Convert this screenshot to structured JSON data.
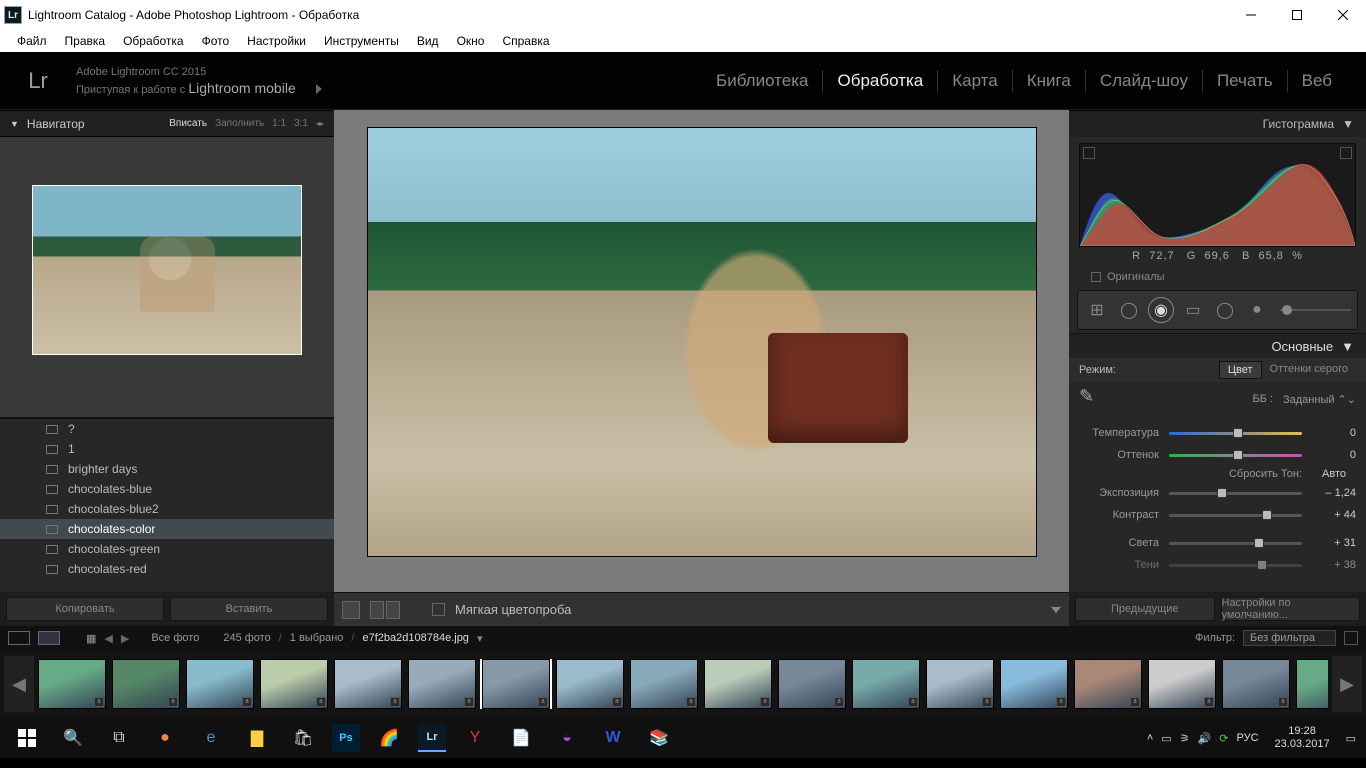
{
  "window": {
    "title": "Lightroom Catalog - Adobe Photoshop Lightroom - Обработка"
  },
  "menubar": [
    "Файл",
    "Правка",
    "Обработка",
    "Фото",
    "Настройки",
    "Инструменты",
    "Вид",
    "Окно",
    "Справка"
  ],
  "identity": {
    "logo": "Lr",
    "version": "Adobe Lightroom CC 2015",
    "mobile_prefix": "Приступая к работе с ",
    "mobile": "Lightroom mobile"
  },
  "modules": [
    {
      "label": "Библиотека",
      "active": false
    },
    {
      "label": "Обработка",
      "active": true
    },
    {
      "label": "Карта",
      "active": false
    },
    {
      "label": "Книга",
      "active": false
    },
    {
      "label": "Слайд-шоу",
      "active": false
    },
    {
      "label": "Печать",
      "active": false
    },
    {
      "label": "Веб",
      "active": false
    }
  ],
  "navigator": {
    "title": "Навигатор",
    "zoom": [
      {
        "l": "Вписать",
        "on": true
      },
      {
        "l": "Заполнить",
        "on": false
      },
      {
        "l": "1:1",
        "on": false
      },
      {
        "l": "3:1",
        "on": false
      }
    ]
  },
  "presets": [
    {
      "label": "?",
      "sel": false
    },
    {
      "label": "1",
      "sel": false
    },
    {
      "label": "brighter days",
      "sel": false
    },
    {
      "label": "chocolates-blue",
      "sel": false
    },
    {
      "label": "chocolates-blue2",
      "sel": false
    },
    {
      "label": "chocolates-color",
      "sel": true
    },
    {
      "label": "chocolates-green",
      "sel": false
    },
    {
      "label": "chocolates-red",
      "sel": false
    }
  ],
  "leftButtons": {
    "copy": "Копировать",
    "paste": "Вставить"
  },
  "centerToolbar": {
    "softproof": "Мягкая цветопроба"
  },
  "rightPanels": {
    "histogram": {
      "title": "Гистограмма",
      "readout": {
        "r": "72,7",
        "g": "69,6",
        "b": "65,8",
        "pct": "%"
      },
      "originals": "Оригиналы"
    },
    "basic": {
      "title": "Основные",
      "mode": {
        "label": "Режим:",
        "color": "Цвет",
        "gray": "Оттенки серого"
      },
      "wb": {
        "label": "ББ :",
        "preset": "Заданный"
      },
      "temperature": {
        "label": "Температура",
        "value": "0"
      },
      "tint": {
        "label": "Оттенок",
        "value": "0"
      },
      "resetTone": "Сбросить Тон:",
      "auto": "Авто",
      "exposure": {
        "label": "Экспозиция",
        "value": "– 1,24"
      },
      "contrast": {
        "label": "Контраст",
        "value": "+ 44"
      },
      "highlights": {
        "label": "Света",
        "value": "+ 31"
      },
      "shadows": {
        "label": "Тени",
        "value": "+ 38"
      }
    }
  },
  "rightButtons": {
    "prev": "Предыдущие",
    "reset": "Настройки по умолчанию..."
  },
  "infobar": {
    "all": "Все фото",
    "count": "245 фото",
    "selected": "1 выбрано",
    "filename": "e7f2ba2d108784e.jpg",
    "filterLabel": "Фильтр:",
    "filterValue": "Без фильтра"
  },
  "taskbar": {
    "lang": "РУС",
    "time": "19:28",
    "date": "23.03.2017"
  }
}
